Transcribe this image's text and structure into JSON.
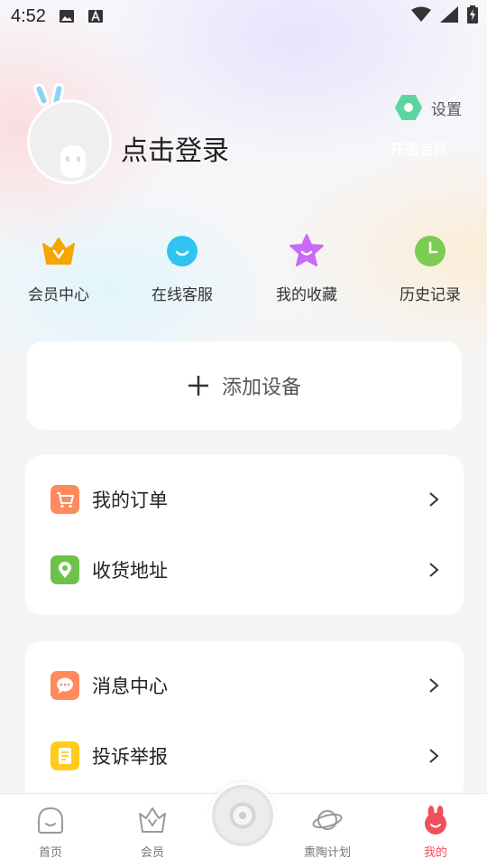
{
  "status_bar": {
    "time": "4:52",
    "icons": [
      "image-icon",
      "font-a-icon",
      "wifi-icon",
      "signal-icon",
      "battery-icon"
    ]
  },
  "profile": {
    "login_text": "点击登录",
    "settings_label": "设置",
    "open_vip_label": "开通会员"
  },
  "quick_actions": [
    {
      "label": "会员中心",
      "icon": "crown-icon",
      "color": "#f7a500"
    },
    {
      "label": "在线客服",
      "icon": "chat-bubble-icon",
      "color": "#2fc3f0"
    },
    {
      "label": "我的收藏",
      "icon": "star-icon",
      "color": "#c86bf5"
    },
    {
      "label": "历史记录",
      "icon": "clock-icon",
      "color": "#7dcc52"
    }
  ],
  "add_device": {
    "label": "添加设备",
    "icon": "plus-icon"
  },
  "menu_group_1": [
    {
      "label": "我的订单",
      "icon": "cart-icon",
      "color": "#ff8a5c"
    },
    {
      "label": "收货地址",
      "icon": "location-pin-icon",
      "color": "#6cc24a"
    }
  ],
  "menu_group_2": [
    {
      "label": "消息中心",
      "icon": "message-icon",
      "color": "#ff8a5c"
    },
    {
      "label": "投诉举报",
      "icon": "document-icon",
      "color": "#ffcc1c"
    }
  ],
  "tabbar": {
    "items": [
      {
        "label": "首页",
        "icon": "home-icon"
      },
      {
        "label": "会员",
        "icon": "crown-outline-icon"
      },
      {
        "label": "熏陶计划",
        "icon": "planet-icon"
      },
      {
        "label": "我的",
        "icon": "rabbit-icon",
        "active": true
      }
    ],
    "active_color": "#f24e5c"
  }
}
